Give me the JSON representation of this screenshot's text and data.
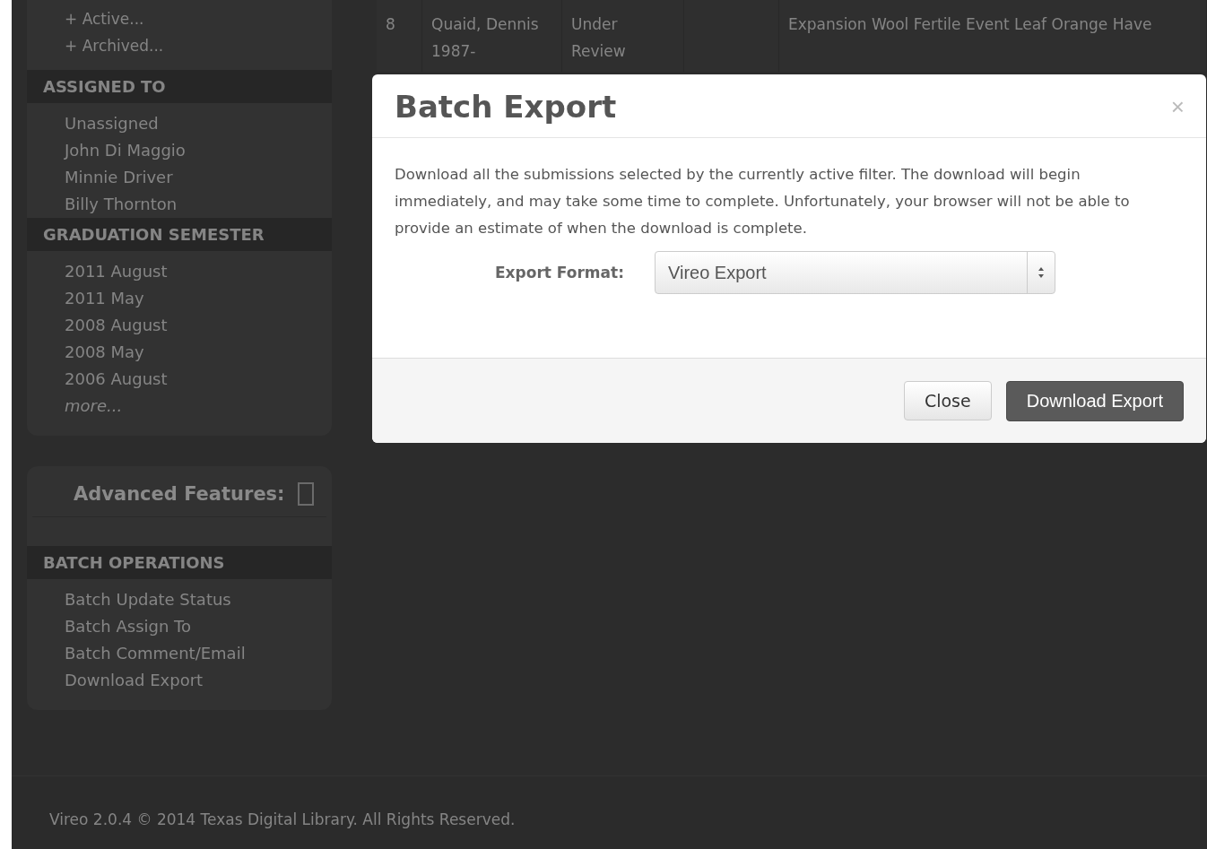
{
  "sidebar": {
    "status_links": [
      {
        "label": "+ Active..."
      },
      {
        "label": "+ Archived..."
      }
    ],
    "filter_groups": [
      {
        "heading": "ASSIGNED TO",
        "items": [
          {
            "label": "Unassigned",
            "italic": false
          },
          {
            "label": "John Di Maggio",
            "italic": false
          },
          {
            "label": "Minnie Driver",
            "italic": false
          },
          {
            "label": "Billy Thornton",
            "italic": false
          }
        ]
      },
      {
        "heading": "GRADUATION SEMESTER",
        "items": [
          {
            "label": "2011 August",
            "italic": false
          },
          {
            "label": "2011 May",
            "italic": false
          },
          {
            "label": "2008 August",
            "italic": false
          },
          {
            "label": "2008 May",
            "italic": false
          },
          {
            "label": "2006 August",
            "italic": false
          },
          {
            "label": "more...",
            "italic": true
          }
        ]
      }
    ],
    "advanced": {
      "title": "Advanced Features:",
      "heading": "BATCH OPERATIONS",
      "items": [
        {
          "label": "Batch Update Status"
        },
        {
          "label": "Batch Assign To"
        },
        {
          "label": "Batch Comment/Email"
        },
        {
          "label": "Download Export"
        }
      ]
    }
  },
  "table": {
    "rows": [
      {
        "number": "8",
        "author": "Quaid, Dennis 1987-",
        "status": "Under Review",
        "title": "Expansion Wool Fertile Event Leaf Orange Have"
      }
    ]
  },
  "modal": {
    "title": "Batch Export",
    "close": "×",
    "body": "Download all the submissions selected by the currently active filter. The download will begin immediately, and may take some time to complete. Unfortunately, your browser will not be able to provide an estimate of when the download is complete.",
    "field_label": "Export Format:",
    "field_value": "Vireo Export",
    "buttons": [
      {
        "label": "Close",
        "kind": "secondary"
      },
      {
        "label": "Download Export",
        "kind": "primary"
      }
    ]
  },
  "footer": {
    "text": "Vireo 2.0.4 © 2014 Texas Digital Library. All Rights Reserved."
  }
}
